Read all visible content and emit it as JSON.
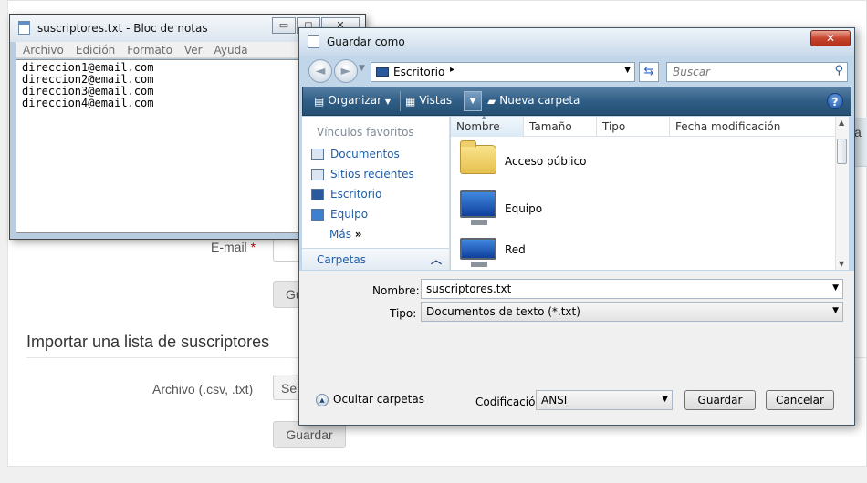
{
  "webpage": {
    "email_label": "E-mail",
    "required_mark": "*",
    "submit_button_fragment": "Gu",
    "import_section_title": "Importar una lista de suscriptores",
    "file_label": "Archivo (.csv, .txt)",
    "select_button_fragment": "Sel",
    "save_button": "Guardar",
    "side_fragment": "a"
  },
  "notepad": {
    "title": "suscriptores.txt - Bloc de notas",
    "window_buttons": [
      "▭",
      "◻",
      "✕"
    ],
    "menu": [
      "Archivo",
      "Edición",
      "Formato",
      "Ver",
      "Ayuda"
    ],
    "lines": [
      "direccion1@email.com",
      "direccion2@email.com",
      "direccion3@email.com",
      "direccion4@email.com"
    ]
  },
  "dialog": {
    "title": "Guardar como",
    "close_glyph": "✕",
    "address": {
      "location": "Escritorio",
      "arrow": "▸",
      "search_placeholder": "Buscar"
    },
    "toolbar": {
      "organize": "Organizar",
      "views": "Vistas",
      "new_folder": "Nueva carpeta",
      "help": "?"
    },
    "favorites": {
      "header": "Vínculos favoritos",
      "items": [
        "Documentos",
        "Sitios recientes",
        "Escritorio",
        "Equipo"
      ],
      "more": "Más",
      "more_glyph": "»"
    },
    "folders_label": "Carpetas",
    "columns": [
      "Nombre",
      "Tamaño",
      "Tipo",
      "Fecha modificación"
    ],
    "files": [
      "Acceso público",
      "Equipo",
      "Red"
    ],
    "name_label": "Nombre:",
    "name_value": "suscriptores.txt",
    "type_label": "Tipo:",
    "type_value": "Documentos de texto (*.txt)",
    "hide_folders": "Ocultar carpetas",
    "encoding_label": "Codificación:",
    "encoding_value": "ANSI",
    "save_button": "Guardar",
    "cancel_button": "Cancelar"
  },
  "colors": {
    "toolbar_blue": "#2f5d85",
    "link_blue": "#1e5ea8",
    "close_red": "#c7452e"
  }
}
